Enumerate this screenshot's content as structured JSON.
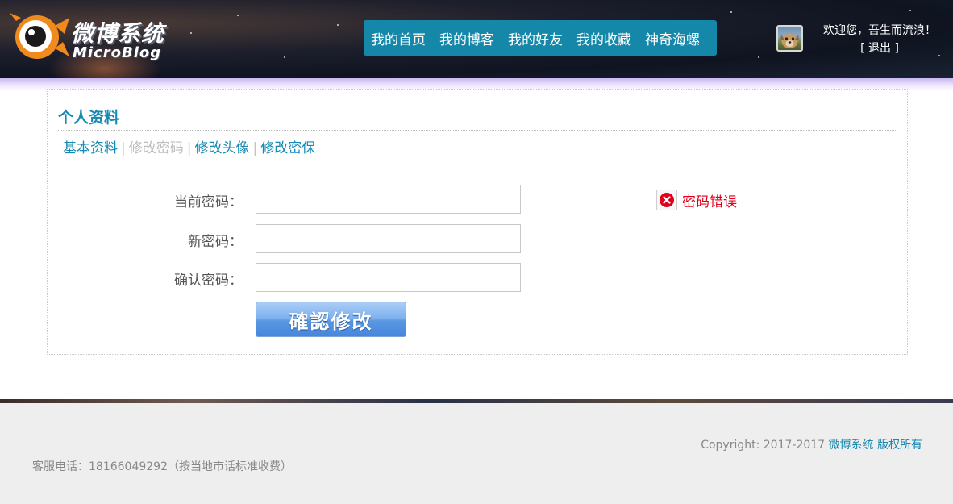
{
  "header": {
    "logo_title": "微博系统",
    "logo_subtitle": "MicroBlog",
    "nav": [
      "我的首页",
      "我的博客",
      "我的好友",
      "我的收藏",
      "神奇海螺"
    ],
    "welcome": "欢迎您，吾生而流浪！",
    "logout": "[ 退出 ]"
  },
  "panel": {
    "title": "个人资料",
    "subnav": {
      "basic": "基本资料",
      "password": "修改密码",
      "avatar": "修改头像",
      "security": "修改密保"
    },
    "form": {
      "current_label": "当前密码：",
      "current_value": "",
      "new_label": "新密码：",
      "new_value": "",
      "confirm_label": "确认密码：",
      "confirm_value": "",
      "submit": "確認修改"
    },
    "error": "密码错误"
  },
  "footer": {
    "copyright_prefix": "Copyright: 2017-2017 ",
    "copyright_brand": "微博系统 版权所有",
    "service": "客服电话：18166049292（按当地市话标准收费）"
  },
  "colors": {
    "accent": "#1589b1",
    "nav_bg": "#1588a9",
    "error": "#e0001b"
  }
}
